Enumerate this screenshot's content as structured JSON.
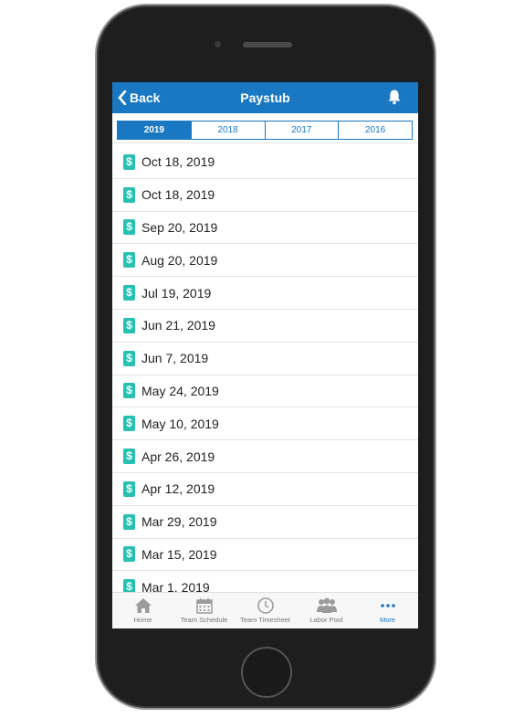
{
  "header": {
    "back_label": "Back",
    "title": "Paystub"
  },
  "tabs": [
    {
      "label": "2019",
      "active": true
    },
    {
      "label": "2018",
      "active": false
    },
    {
      "label": "2017",
      "active": false
    },
    {
      "label": "2016",
      "active": false
    }
  ],
  "paystubs": [
    "Oct 18, 2019",
    "Oct 18, 2019",
    "Sep 20, 2019",
    "Aug 20, 2019",
    "Jul 19, 2019",
    "Jun 21, 2019",
    "Jun 7, 2019",
    "May 24, 2019",
    "May 10, 2019",
    "Apr 26, 2019",
    "Apr 12, 2019",
    "Mar 29, 2019",
    "Mar 15, 2019",
    "Mar 1, 2019"
  ],
  "dollar_glyph": "$",
  "nav": [
    {
      "label": "Home",
      "icon": "home-icon"
    },
    {
      "label": "Team Schedule",
      "icon": "calendar-icon"
    },
    {
      "label": "Team Timesheet",
      "icon": "clock-icon"
    },
    {
      "label": "Labor Pool",
      "icon": "people-icon"
    },
    {
      "label": "More",
      "icon": "more-icon",
      "active": true
    }
  ],
  "colors": {
    "primary": "#1a78c2",
    "dollar_badge": "#27c1b2"
  }
}
